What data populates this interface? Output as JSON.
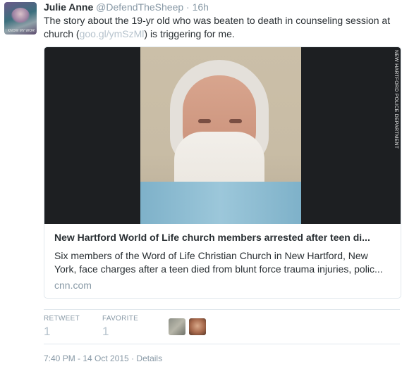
{
  "tweet": {
    "author_name": "Julie Anne",
    "author_handle": "@DefendTheSheep",
    "separator": "·",
    "relative_time": "16h",
    "avatar_caption": "I KNOW MY WORTH",
    "text_before_link": "The story about the 19-yr old who was beaten to death in counseling session at church (",
    "link_text": "goo.gl/ymSzMl",
    "text_after_link": ") is triggering for me."
  },
  "card": {
    "media_label": "NEW HARTFORD POLICE DEPARTMENT",
    "title": "New Hartford World of Life church members arrested after teen di...",
    "description_line1": "Six members of the Word of Life Christian Church in New Hartford, New",
    "description_line2": "York, face charges after a teen died from blunt force trauma injuries, polic...",
    "domain": "cnn.com"
  },
  "stats": {
    "retweet_label": "RETWEET",
    "retweet_count": "1",
    "favorite_label": "FAVORITE",
    "favorite_count": "1"
  },
  "footer": {
    "timestamp": "7:40 PM - 14 Oct 2015",
    "separator": "·",
    "details_label": "Details"
  },
  "colors": {
    "text": "#292f33",
    "muted": "#8899a6",
    "link": "#b6c3cd",
    "border": "#e1e8ed"
  }
}
